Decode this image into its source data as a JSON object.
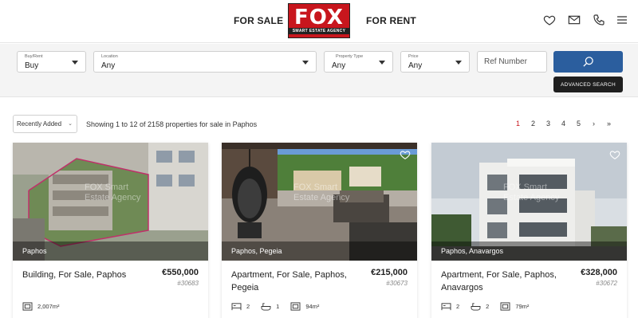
{
  "header": {
    "nav_for_sale": "FOR SALE",
    "nav_for_rent": "FOR RENT",
    "logo_text": "FOX",
    "logo_tagline": "SMART ESTATE AGENCY",
    "brand_color": "#c8161d",
    "icons": [
      "heart-icon",
      "mail-icon",
      "phone-icon",
      "menu-icon"
    ]
  },
  "search": {
    "buy_rent": {
      "label": "Buy/Rent",
      "value": "Buy"
    },
    "location": {
      "label": "Location",
      "value": "Any"
    },
    "property_type": {
      "label": "Property Type",
      "value": "Any"
    },
    "price": {
      "label": "Price",
      "value": "Any"
    },
    "ref_placeholder": "Ref Number",
    "advanced_label": "ADVANCED SEARCH",
    "button_color": "#2b5e9e"
  },
  "results": {
    "sort_value": "Recently Added",
    "summary": "Showing 1 to 12 of 2158 properties for sale in Paphos",
    "pages": [
      "1",
      "2",
      "3",
      "4",
      "5",
      "›",
      "»"
    ],
    "active_page": "1"
  },
  "listings": [
    {
      "location": "Paphos",
      "title": "Building, For Sale, Paphos",
      "price": "€550,000",
      "ref": "#30683",
      "area": "2,007m²"
    },
    {
      "location": "Paphos, Pegeia",
      "title": "Apartment, For Sale, Paphos, Pegeia",
      "price": "€215,000",
      "ref": "#30673",
      "beds": "2",
      "baths": "1",
      "area": "94m²"
    },
    {
      "location": "Paphos, Anavargos",
      "title": "Apartment, For Sale, Paphos, Anavargos",
      "price": "€328,000",
      "ref": "#30672",
      "beds": "2",
      "baths": "2",
      "area": "79m²"
    }
  ]
}
